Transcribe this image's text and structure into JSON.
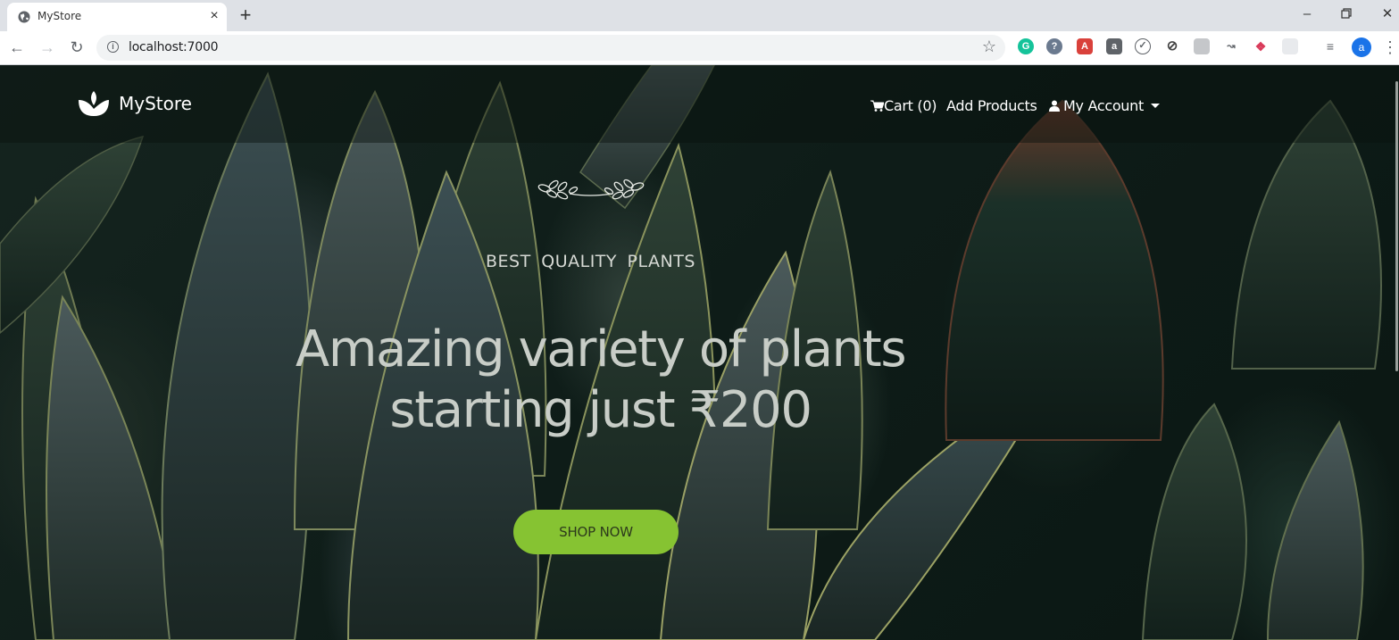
{
  "browser": {
    "tab_title": "MyStore",
    "url": "localhost:7000",
    "profile_initial": "a",
    "new_tab_symbol": "+",
    "close_symbol": "×"
  },
  "navbar": {
    "brand": "MyStore",
    "cart_label": "Cart (0)",
    "add_products_label": "Add Products",
    "account_label": "My Account"
  },
  "hero": {
    "tagline": "BEST QUALITY PLANTS",
    "headline_line1": "Amazing variety of plants",
    "headline_line2": "starting just ₹200",
    "cta_label": "SHOP NOW",
    "cta_color": "#86c332"
  },
  "colors": {
    "accent": "#86c332",
    "profile": "#1a73e8"
  }
}
